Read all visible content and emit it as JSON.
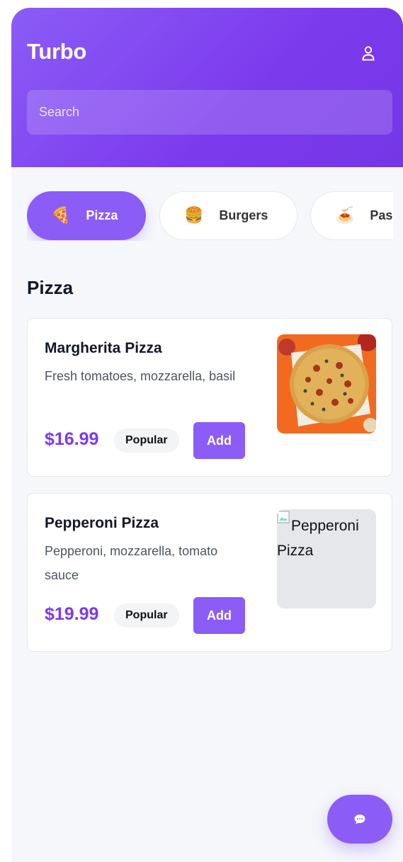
{
  "header": {
    "title": "Turbo",
    "profile_icon": "user-icon",
    "search": {
      "placeholder": "Search",
      "value": ""
    }
  },
  "categories": [
    {
      "label": "Pizza",
      "emoji": "🍕",
      "active": true
    },
    {
      "label": "Burgers",
      "emoji": "🍔",
      "active": false
    },
    {
      "label": "Pas",
      "emoji": "🍝",
      "active": false
    }
  ],
  "section": {
    "title": "Pizza"
  },
  "items": [
    {
      "name": "Margherita Pizza",
      "description": "Fresh tomatoes, mozzarella, basil",
      "price": "$16.99",
      "badge": "Popular",
      "add_label": "Add",
      "image_alt": ""
    },
    {
      "name": "Pepperoni Pizza",
      "description": "Pepperoni, mozzarella, tomato sauce",
      "price": "$19.99",
      "badge": "Popular",
      "add_label": "Add",
      "image_alt": "Pepperoni Pizza"
    }
  ],
  "fab": {
    "icon": "chat-bubble-icon"
  },
  "colors": {
    "accent": "#8b5cf6",
    "price": "#7c3aed",
    "background": "#f5f7fa"
  }
}
